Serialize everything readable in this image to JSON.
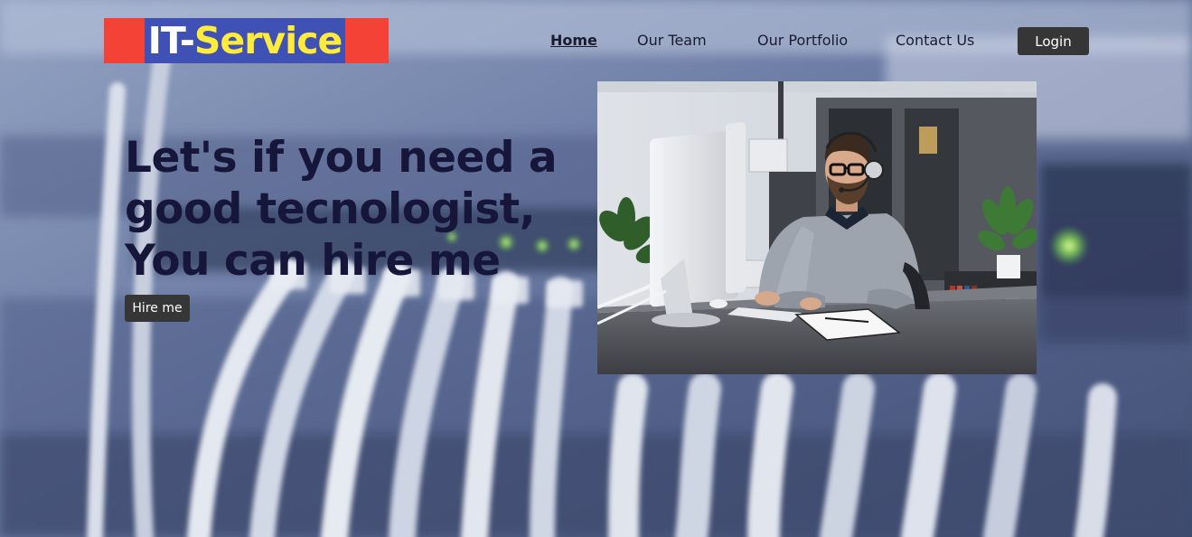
{
  "header": {
    "logo": {
      "part1": "IT-",
      "part2": "Service"
    },
    "nav": [
      {
        "label": "Home",
        "active": true
      },
      {
        "label": "Our Team",
        "active": false
      },
      {
        "label": "Our Portfolio",
        "active": false
      },
      {
        "label": "Contact Us",
        "active": false
      }
    ],
    "login_label": "Login"
  },
  "hero": {
    "title_lines": [
      "Let's if you need a",
      "good tecnologist,",
      "You can hire me"
    ],
    "cta_label": "Hire me"
  },
  "colors": {
    "logo_red": "#f44336",
    "logo_blue": "#3f51b5",
    "logo_yellow": "#ffeb3b",
    "button_dark": "#363636",
    "heading_navy": "#16163a"
  }
}
